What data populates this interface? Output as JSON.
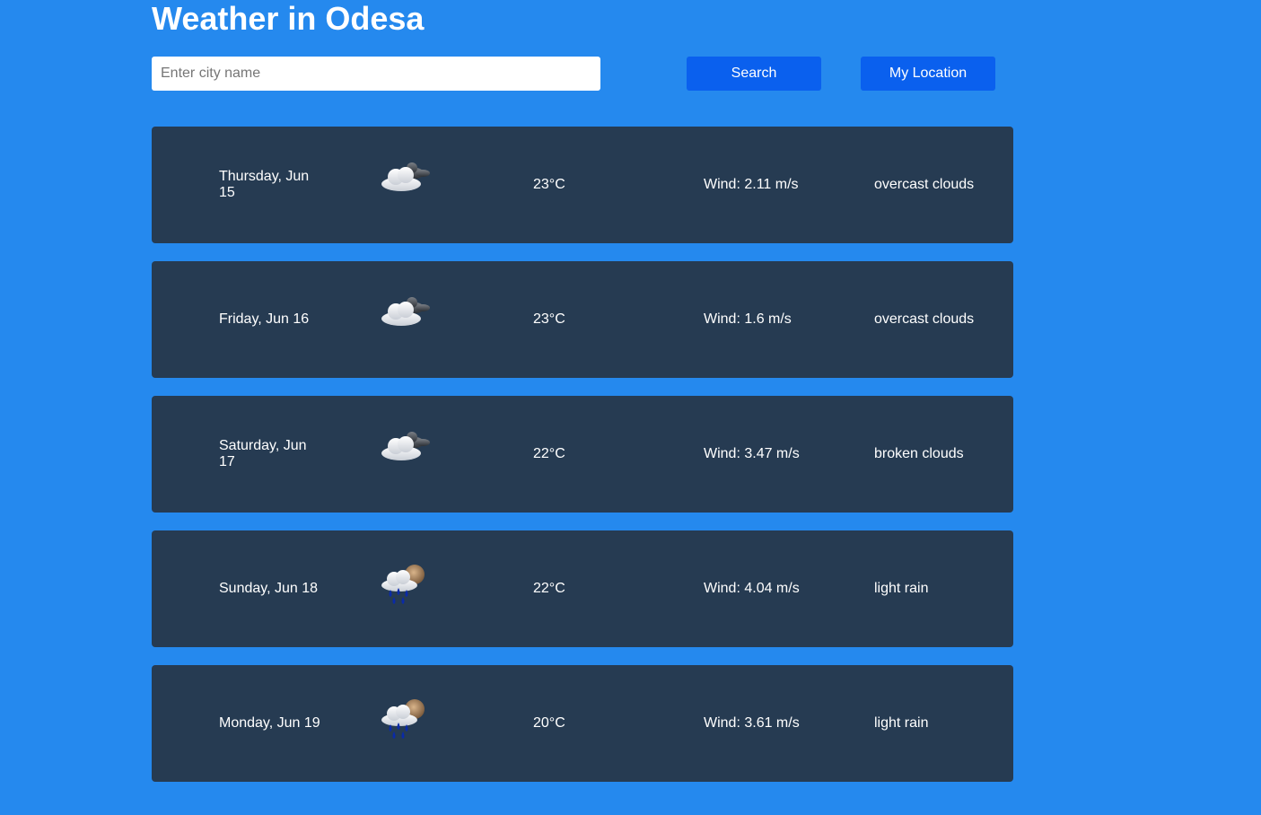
{
  "header": {
    "title": "Weather in Odesa"
  },
  "search": {
    "placeholder": "Enter city name",
    "value": "",
    "search_label": "Search",
    "location_label": "My Location"
  },
  "forecast": [
    {
      "date": "Thursday, Jun 15",
      "icon": "overcast-clouds-icon",
      "temp": "23°C",
      "wind": "Wind: 2.11 m/s",
      "description": "overcast clouds"
    },
    {
      "date": "Friday, Jun 16",
      "icon": "overcast-clouds-icon",
      "temp": "23°C",
      "wind": "Wind: 1.6 m/s",
      "description": "overcast clouds"
    },
    {
      "date": "Saturday, Jun 17",
      "icon": "broken-clouds-icon",
      "temp": "22°C",
      "wind": "Wind: 3.47 m/s",
      "description": "broken clouds"
    },
    {
      "date": "Sunday, Jun 18",
      "icon": "light-rain-icon",
      "temp": "22°C",
      "wind": "Wind: 4.04 m/s",
      "description": "light rain"
    },
    {
      "date": "Monday, Jun 19",
      "icon": "light-rain-icon",
      "temp": "20°C",
      "wind": "Wind: 3.61 m/s",
      "description": "light rain"
    }
  ],
  "colors": {
    "background": "#2589ee",
    "card": "#263b52",
    "button": "#0a60ee",
    "text": "#ffffff"
  }
}
